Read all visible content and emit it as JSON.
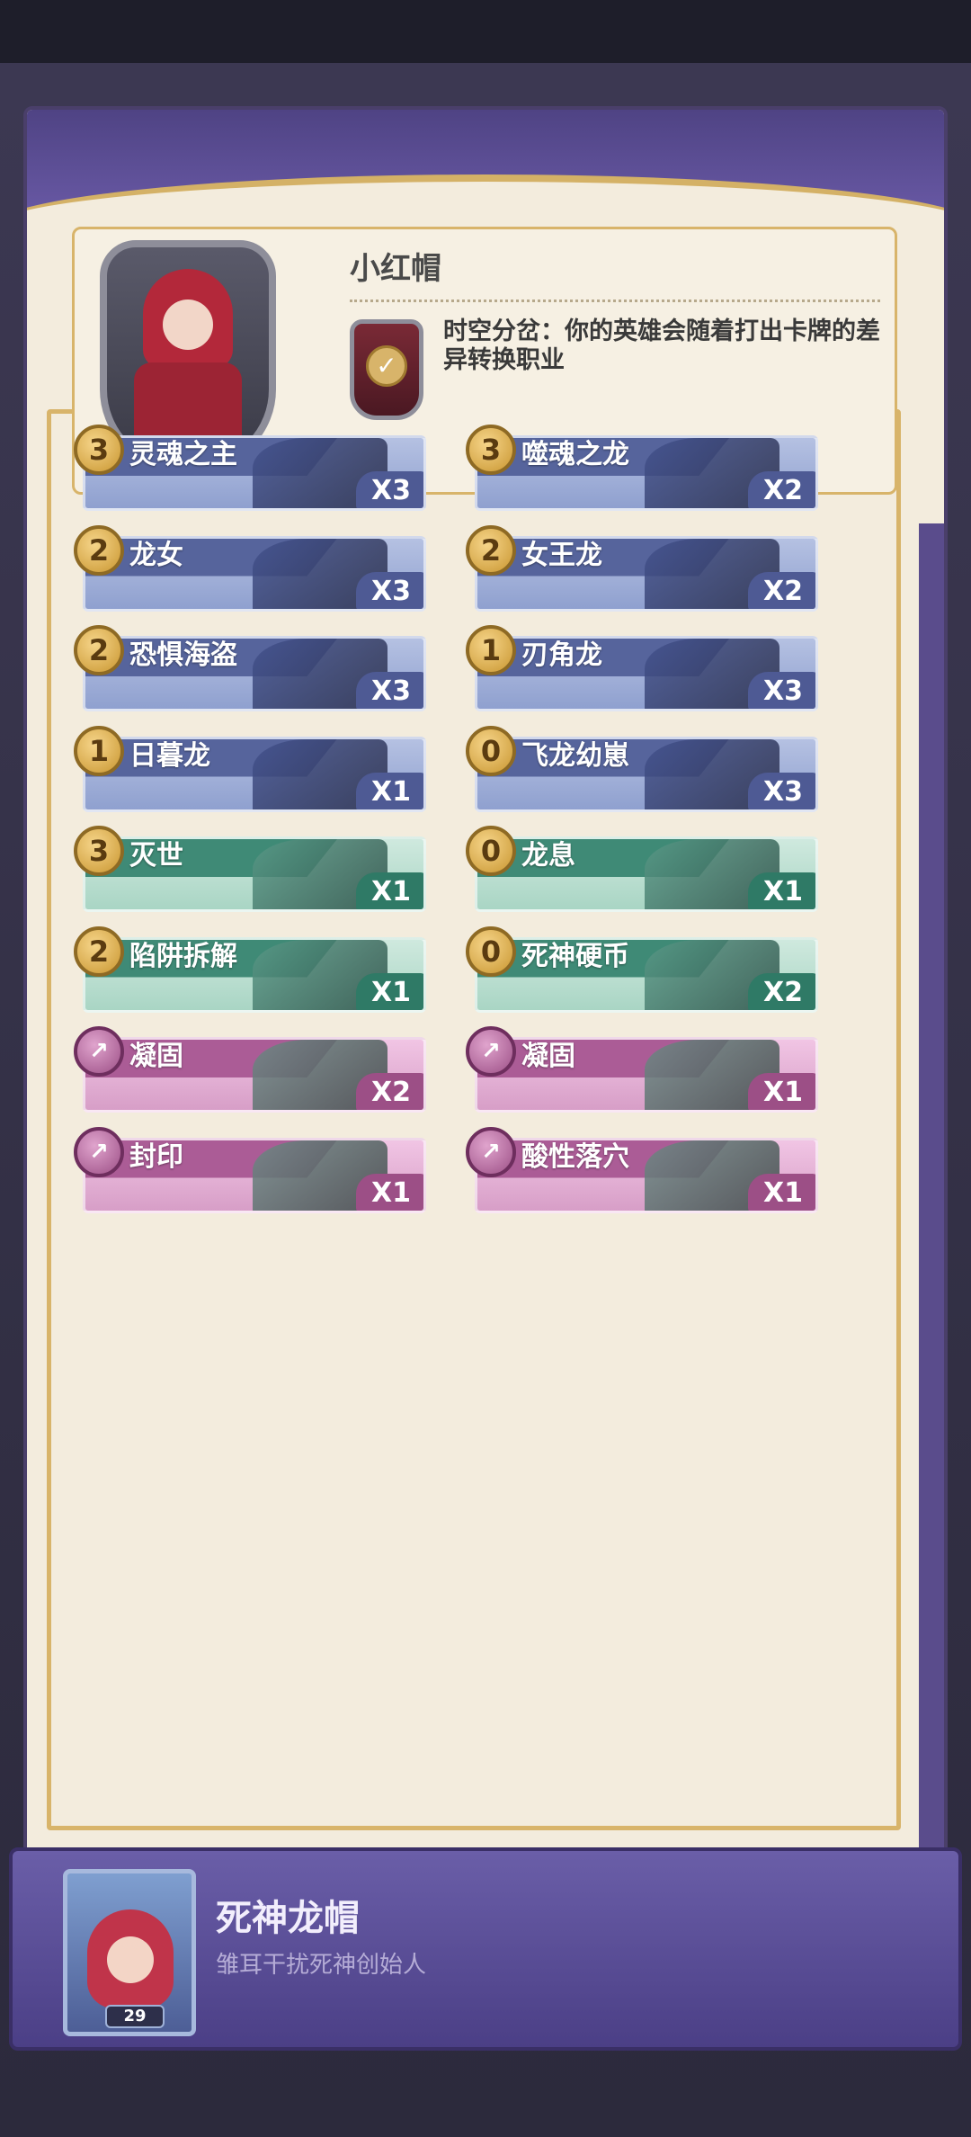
{
  "hero": {
    "name": "小红帽",
    "ability": "时空分岔：你的英雄会随着打出卡牌的差异转换职业",
    "portrait_icon": "red-hood-portrait"
  },
  "cards": [
    {
      "cost": "3",
      "name": "灵魂之主",
      "count": "X3",
      "type": "blue"
    },
    {
      "cost": "3",
      "name": "噬魂之龙",
      "count": "X2",
      "type": "blue"
    },
    {
      "cost": "2",
      "name": "龙女",
      "count": "X3",
      "type": "blue"
    },
    {
      "cost": "2",
      "name": "女王龙",
      "count": "X2",
      "type": "blue"
    },
    {
      "cost": "2",
      "name": "恐惧海盗",
      "count": "X3",
      "type": "blue"
    },
    {
      "cost": "1",
      "name": "刃角龙",
      "count": "X3",
      "type": "blue"
    },
    {
      "cost": "1",
      "name": "日暮龙",
      "count": "X1",
      "type": "blue"
    },
    {
      "cost": "0",
      "name": "飞龙幼崽",
      "count": "X3",
      "type": "blue"
    },
    {
      "cost": "3",
      "name": "灭世",
      "count": "X1",
      "type": "green"
    },
    {
      "cost": "0",
      "name": "龙息",
      "count": "X1",
      "type": "green"
    },
    {
      "cost": "2",
      "name": "陷阱拆解",
      "count": "X1",
      "type": "green"
    },
    {
      "cost": "0",
      "name": "死神硬币",
      "count": "X2",
      "type": "green"
    },
    {
      "cost": "↗",
      "name": "凝固",
      "count": "X2",
      "type": "pink"
    },
    {
      "cost": "↗",
      "name": "凝固",
      "count": "X1",
      "type": "pink"
    },
    {
      "cost": "↗",
      "name": "封印",
      "count": "X1",
      "type": "pink"
    },
    {
      "cost": "↗",
      "name": "酸性落穴",
      "count": "X1",
      "type": "pink"
    }
  ],
  "footer": {
    "title": "死神龙帽",
    "subtitle": "雏耳干扰死神创始人",
    "level": "29"
  },
  "colors": {
    "panel": "#f3ecdd",
    "purple": "#4f4384",
    "gold": "#d8b46a",
    "blue_card": "#56649c",
    "green_card": "#3f8a76",
    "pink_card": "#ab5c96"
  }
}
